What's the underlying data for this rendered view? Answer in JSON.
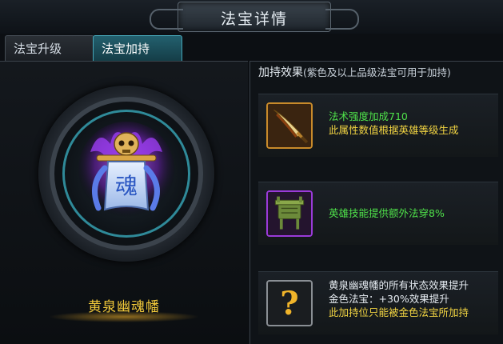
{
  "title": "法宝详情",
  "tabs": [
    {
      "label": "法宝升级",
      "active": false
    },
    {
      "label": "法宝加持",
      "active": true
    }
  ],
  "artifact": {
    "name": "黄泉幽魂幡",
    "glyph": "魂"
  },
  "effects": {
    "header": "加持效果",
    "subheader": "(紫色及以上品级法宝可用于加持)",
    "slots": [
      {
        "icon": "sword-icon",
        "lines": [
          "法术强度加成710",
          "此属性数值根据英雄等级生成"
        ]
      },
      {
        "icon": "cauldron-icon",
        "lines": [
          "英雄技能提供额外法穿8%"
        ]
      },
      {
        "icon": "question-icon",
        "glyph": "?",
        "lines": [
          "黄泉幽魂幡的所有状态效果提升",
          "金色法宝：+30%效果提升",
          "此加持位只能被金色法宝所加持"
        ]
      }
    ]
  },
  "colors": {
    "name_gold": "#f2c93a",
    "effect_green": "#4fe24a",
    "tab_active": "#23606e",
    "ring_teal": "#2f8a99"
  }
}
